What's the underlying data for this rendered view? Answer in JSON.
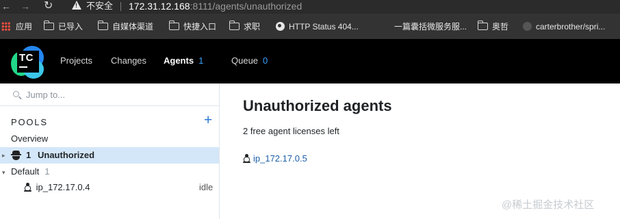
{
  "browser": {
    "not_secure_label": "不安全",
    "url_host": "172.31.12.168",
    "url_path": ":8111/agents/unauthorized"
  },
  "bookmarks": [
    {
      "label": "应用",
      "icon": "apps-grid-icon"
    },
    {
      "label": "已导入",
      "icon": "folder-icon"
    },
    {
      "label": "自媒体渠道",
      "icon": "folder-icon"
    },
    {
      "label": "快捷入口",
      "icon": "folder-icon"
    },
    {
      "label": "求职",
      "icon": "folder-icon"
    },
    {
      "label": "HTTP Status 404...",
      "icon": "globe-icon"
    },
    {
      "label": "一篇囊括微服务服...",
      "icon": ""
    },
    {
      "label": "奥哲",
      "icon": "folder-icon"
    },
    {
      "label": "carterbrother/spri...",
      "icon": "github-icon"
    }
  ],
  "header": {
    "logo_text": "TC",
    "nav": [
      {
        "label": "Projects",
        "count": ""
      },
      {
        "label": "Changes",
        "count": ""
      },
      {
        "label": "Agents",
        "count": "1"
      },
      {
        "label": "Queue",
        "count": "0"
      }
    ],
    "accent_color": "#3aa3ff"
  },
  "sidebar": {
    "search_placeholder": "Jump to...",
    "pools_title": "POOLS",
    "add_symbol": "+",
    "overview_label": "Overview",
    "unauthorized": {
      "count": "1",
      "label": "Unauthorized"
    },
    "default_pool": {
      "label": "Default",
      "count": "1"
    },
    "agent": {
      "name": "ip_172.17.0.4",
      "status": "idle"
    }
  },
  "main": {
    "title": "Unauthorized agents",
    "license_text": "2 free agent licenses left",
    "agent_link": "ip_172.17.0.5"
  },
  "watermark": "@稀土掘金技术社区"
}
